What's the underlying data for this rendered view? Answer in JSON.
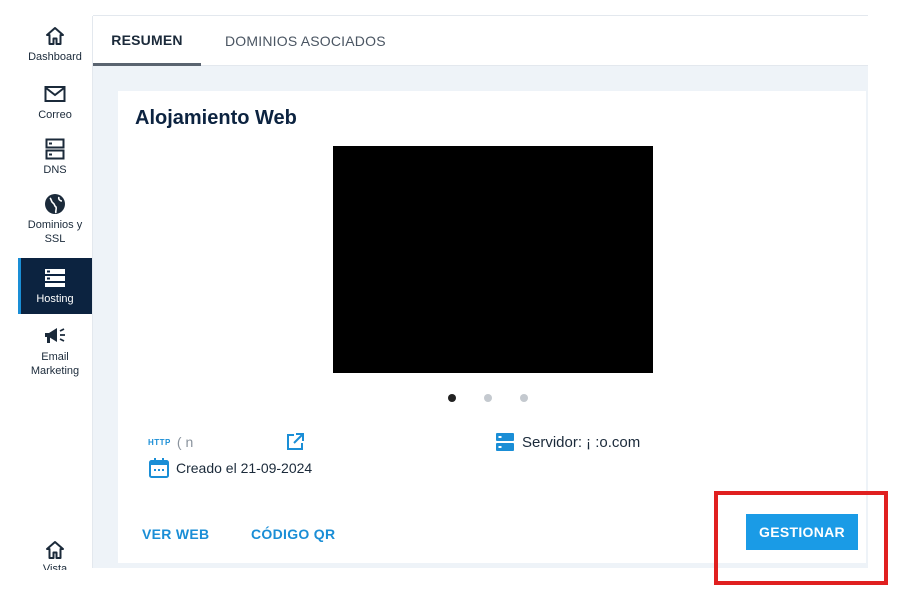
{
  "sidebar": {
    "items": [
      {
        "label": "Dashboard",
        "icon": "home-icon"
      },
      {
        "label": "Correo",
        "icon": "mail-icon"
      },
      {
        "label": "DNS",
        "icon": "dns-icon"
      },
      {
        "label": "Dominios y SSL",
        "icon": "globe-icon"
      },
      {
        "label": "Hosting",
        "icon": "hosting-icon",
        "active": true
      },
      {
        "label": "Email Marketing",
        "icon": "megaphone-icon"
      }
    ],
    "bottom_label": "Vista"
  },
  "tabs": [
    {
      "label": "RESUMEN",
      "active": true
    },
    {
      "label": "DOMINIOS ASOCIADOS",
      "active": false
    }
  ],
  "card": {
    "title": "Alojamiento Web",
    "carousel_dots": 3,
    "active_dot": 0,
    "http_badge": "HTTP",
    "url_text": "(                    n",
    "created": "Creado el 21-09-2024",
    "server_label": "Servidor:",
    "server_value": "¡                         :o.com"
  },
  "actions": {
    "ver_web": "VER WEB",
    "codigo_qr": "CÓDIGO QR",
    "gestionar": "GESTIONAR"
  },
  "colors": {
    "accent": "#1a9be6",
    "navy": "#0c2340",
    "highlight": "#e02020"
  }
}
